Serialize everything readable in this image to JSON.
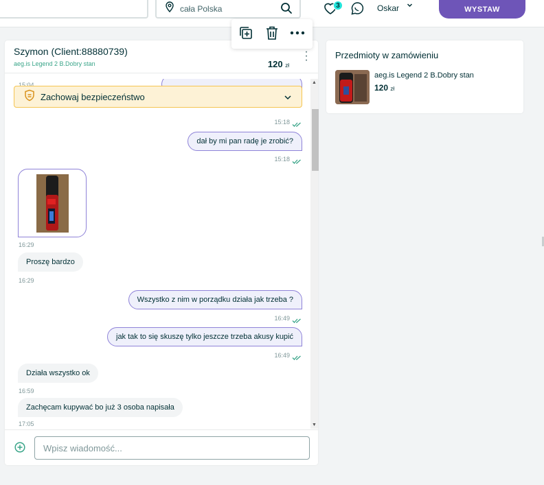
{
  "topbar": {
    "location_placeholder": "cała Polska",
    "favorites_count": "3",
    "user_name": "Oskar",
    "post_button": "WYSTAW"
  },
  "chat": {
    "contact_name": "Szymon (Client:88880739)",
    "item_subtitle": "aeg.is Legend 2 B.Dobry stan",
    "price": "120",
    "currency": "zł",
    "safety_label": "Zachowaj bezpieczeństwo",
    "messages": [
      {
        "dir": "out",
        "text": "",
        "time": "15:18"
      },
      {
        "dir": "out",
        "text": "dał by mi pan radę je zrobić?",
        "time": "15:18"
      },
      {
        "dir": "in",
        "type": "image",
        "time": "16:29"
      },
      {
        "dir": "in",
        "text": "Proszę bardzo",
        "time": "16:29"
      },
      {
        "dir": "out",
        "text": "Wszystko z nim w porządku działa jak trzeba ?",
        "time": "16:49"
      },
      {
        "dir": "out",
        "text": "jak tak to się skuszę tylko jeszcze trzeba akusy kupić",
        "time": "16:49"
      },
      {
        "dir": "in",
        "text": "Działa wszystko ok",
        "time": "16:59"
      },
      {
        "dir": "in",
        "text": "Zachęcam kupywać bo już 3 osoba napisała",
        "time": "17:05"
      }
    ],
    "first_time_partial": "15:04",
    "composer_placeholder": "Wpisz wiadomość..."
  },
  "order": {
    "title": "Przedmioty w zamówieniu",
    "item_name": "aeg.is Legend 2 B.Dobry stan",
    "price": "120",
    "currency": "zł"
  },
  "colors": {
    "accent": "#6e55b8",
    "outgoing_bubble": "#eff0fb",
    "incoming_bubble": "#f2f4f5",
    "read_check": "#3aa589",
    "safety_bg": "#fdf2d6",
    "safety_border": "#f5c451"
  }
}
